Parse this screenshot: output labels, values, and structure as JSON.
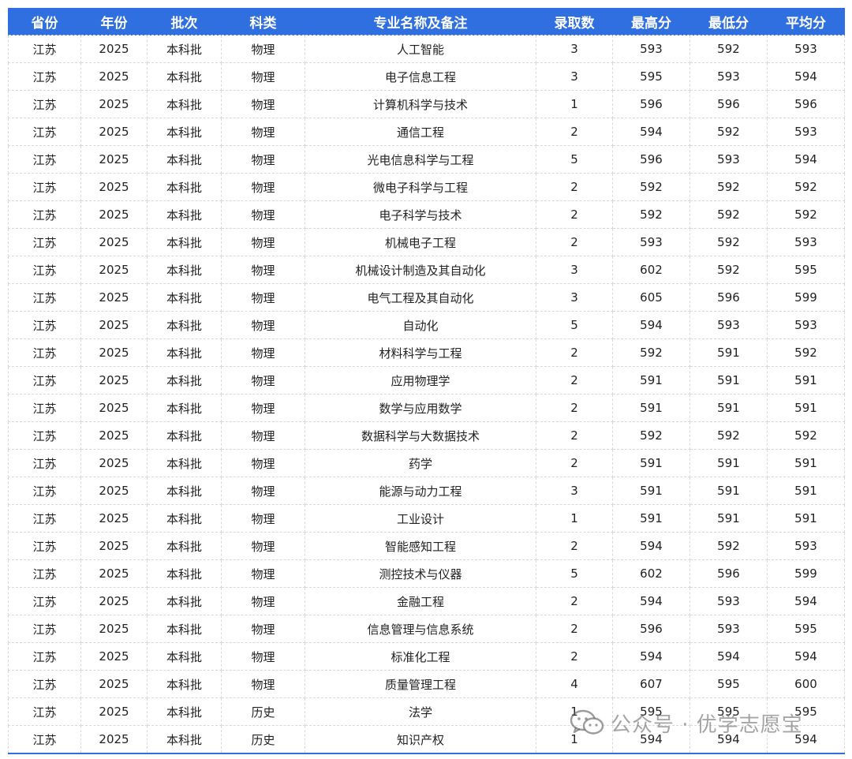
{
  "headers": [
    "省份",
    "年份",
    "批次",
    "科类",
    "专业名称及备注",
    "录取数",
    "最高分",
    "最低分",
    "平均分"
  ],
  "rows": [
    [
      "江苏",
      "2025",
      "本科批",
      "物理",
      "人工智能",
      "3",
      "593",
      "592",
      "593"
    ],
    [
      "江苏",
      "2025",
      "本科批",
      "物理",
      "电子信息工程",
      "3",
      "595",
      "593",
      "594"
    ],
    [
      "江苏",
      "2025",
      "本科批",
      "物理",
      "计算机科学与技术",
      "1",
      "596",
      "596",
      "596"
    ],
    [
      "江苏",
      "2025",
      "本科批",
      "物理",
      "通信工程",
      "2",
      "594",
      "592",
      "593"
    ],
    [
      "江苏",
      "2025",
      "本科批",
      "物理",
      "光电信息科学与工程",
      "5",
      "596",
      "593",
      "594"
    ],
    [
      "江苏",
      "2025",
      "本科批",
      "物理",
      "微电子科学与工程",
      "2",
      "592",
      "592",
      "592"
    ],
    [
      "江苏",
      "2025",
      "本科批",
      "物理",
      "电子科学与技术",
      "2",
      "592",
      "592",
      "592"
    ],
    [
      "江苏",
      "2025",
      "本科批",
      "物理",
      "机械电子工程",
      "2",
      "593",
      "592",
      "593"
    ],
    [
      "江苏",
      "2025",
      "本科批",
      "物理",
      "机械设计制造及其自动化",
      "3",
      "602",
      "592",
      "595"
    ],
    [
      "江苏",
      "2025",
      "本科批",
      "物理",
      "电气工程及其自动化",
      "3",
      "605",
      "596",
      "599"
    ],
    [
      "江苏",
      "2025",
      "本科批",
      "物理",
      "自动化",
      "5",
      "594",
      "593",
      "593"
    ],
    [
      "江苏",
      "2025",
      "本科批",
      "物理",
      "材料科学与工程",
      "2",
      "592",
      "591",
      "592"
    ],
    [
      "江苏",
      "2025",
      "本科批",
      "物理",
      "应用物理学",
      "2",
      "591",
      "591",
      "591"
    ],
    [
      "江苏",
      "2025",
      "本科批",
      "物理",
      "数学与应用数学",
      "2",
      "591",
      "591",
      "591"
    ],
    [
      "江苏",
      "2025",
      "本科批",
      "物理",
      "数据科学与大数据技术",
      "2",
      "592",
      "592",
      "592"
    ],
    [
      "江苏",
      "2025",
      "本科批",
      "物理",
      "药学",
      "2",
      "591",
      "591",
      "591"
    ],
    [
      "江苏",
      "2025",
      "本科批",
      "物理",
      "能源与动力工程",
      "3",
      "591",
      "591",
      "591"
    ],
    [
      "江苏",
      "2025",
      "本科批",
      "物理",
      "工业设计",
      "1",
      "591",
      "591",
      "591"
    ],
    [
      "江苏",
      "2025",
      "本科批",
      "物理",
      "智能感知工程",
      "2",
      "594",
      "592",
      "593"
    ],
    [
      "江苏",
      "2025",
      "本科批",
      "物理",
      "测控技术与仪器",
      "5",
      "602",
      "596",
      "599"
    ],
    [
      "江苏",
      "2025",
      "本科批",
      "物理",
      "金融工程",
      "2",
      "594",
      "593",
      "594"
    ],
    [
      "江苏",
      "2025",
      "本科批",
      "物理",
      "信息管理与信息系统",
      "2",
      "596",
      "593",
      "595"
    ],
    [
      "江苏",
      "2025",
      "本科批",
      "物理",
      "标准化工程",
      "2",
      "594",
      "594",
      "594"
    ],
    [
      "江苏",
      "2025",
      "本科批",
      "物理",
      "质量管理工程",
      "4",
      "607",
      "595",
      "600"
    ],
    [
      "江苏",
      "2025",
      "本科批",
      "历史",
      "法学",
      "1",
      "595",
      "595",
      "595"
    ],
    [
      "江苏",
      "2025",
      "本科批",
      "历史",
      "知识产权",
      "1",
      "594",
      "594",
      "594"
    ]
  ],
  "watermark": {
    "text": "公众号 · 优学志愿宝",
    "icon": "wechat-icon"
  },
  "colors": {
    "header_bg": "#2f6fe0",
    "header_text": "#ffffff",
    "cell_text": "#222222",
    "grid": "#d9d9d9"
  }
}
